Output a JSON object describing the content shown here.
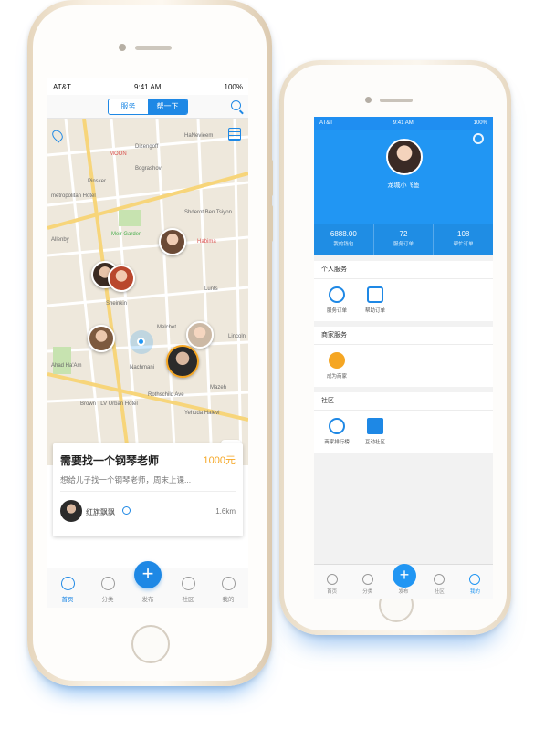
{
  "colors": {
    "accent": "#1e88e5",
    "price": "#f5a623",
    "gold_frame": "#f3e9d8"
  },
  "front": {
    "status": {
      "carrier": "AT&T",
      "time": "9:41 AM",
      "battery": "100%"
    },
    "nav": {
      "segments": [
        "服务",
        "帮一下"
      ],
      "active_segment": "帮一下",
      "icons": [
        "location-icon",
        "search-icon",
        "list-icon"
      ]
    },
    "map": {
      "labels": [
        "HaNevieem",
        "MOON",
        "Dizengoff",
        "Bograshov",
        "Pinsker",
        "metropolitan Hotel",
        "Meir Garden",
        "Habima",
        "Shderot Ben Tsiyon",
        "Allenby",
        "Sheinkin",
        "Lunts",
        "Melchet",
        "Lincoln",
        "Nachmani",
        "Brown TLV Urban Hotel",
        "Rothschild Ave",
        "Mazeh",
        "Yehuda Halevi",
        "Ahad Ha'Am"
      ]
    },
    "card": {
      "title": "需要找一个钢琴老师",
      "price": "1000元",
      "description": "想给儿子找一个钢琴老师，周末上课...",
      "user": "红旗飘飘",
      "distance": "1.6km"
    },
    "tabs": [
      {
        "label": "首页",
        "icon": "home-icon",
        "active": true
      },
      {
        "label": "分类",
        "icon": "category-icon",
        "active": false
      },
      {
        "label": "发布",
        "icon": "plus-icon",
        "active": false
      },
      {
        "label": "社区",
        "icon": "compass-icon",
        "active": false
      },
      {
        "label": "我的",
        "icon": "user-icon",
        "active": false
      }
    ]
  },
  "back": {
    "status": {
      "carrier": "AT&T",
      "time": "9:41 AM",
      "battery": "100%"
    },
    "profile": {
      "name": "龙城小飞鱼"
    },
    "stats": [
      {
        "value": "6888.00",
        "label": "我的钱包"
      },
      {
        "value": "72",
        "label": "服务订单"
      },
      {
        "value": "108",
        "label": "帮忙订单"
      }
    ],
    "sections": [
      {
        "title": "个人服务",
        "items": [
          "服务订单",
          "帮助订单"
        ]
      },
      {
        "title": "商家服务",
        "items": [
          "成为商家"
        ]
      },
      {
        "title": "社区",
        "items": [
          "商家排行榜",
          "互动社区"
        ]
      }
    ],
    "tabs": [
      {
        "label": "首页",
        "active": false
      },
      {
        "label": "分类",
        "active": false
      },
      {
        "label": "发布",
        "active": false
      },
      {
        "label": "社区",
        "active": false
      },
      {
        "label": "我的",
        "active": true
      }
    ]
  }
}
